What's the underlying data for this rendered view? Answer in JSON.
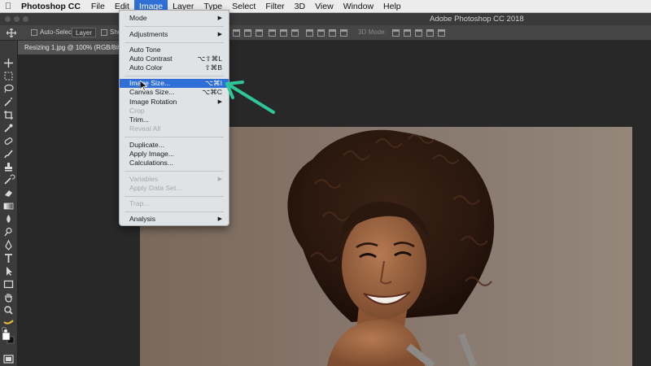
{
  "menubar": {
    "app_name": "Photoshop CC",
    "items": [
      {
        "label": "File"
      },
      {
        "label": "Edit"
      },
      {
        "label": "Image",
        "active": true
      },
      {
        "label": "Layer"
      },
      {
        "label": "Type"
      },
      {
        "label": "Select"
      },
      {
        "label": "Filter"
      },
      {
        "label": "3D"
      },
      {
        "label": "View"
      },
      {
        "label": "Window"
      },
      {
        "label": "Help"
      }
    ]
  },
  "window": {
    "title": "Adobe Photoshop CC 2018"
  },
  "options_bar": {
    "auto_select_label": "Auto-Select:",
    "auto_select_value": "Layer",
    "show_label": "Sho",
    "mode_3d_label": "3D Mode:"
  },
  "document": {
    "tab_label": "Resizing 1.jpg @ 100% (RGB/8#"
  },
  "image_menu": {
    "items": [
      {
        "label": "Mode",
        "submenu": true
      },
      {
        "label": "Adjustments",
        "submenu": true
      },
      {
        "label": "Auto Tone",
        "shortcut": ""
      },
      {
        "label": "Auto Contrast",
        "shortcut": "⌥⇧⌘L"
      },
      {
        "label": "Auto Color",
        "shortcut": "⇧⌘B"
      },
      {
        "label": "Image Size...",
        "shortcut": "⌥⌘I",
        "highlighted": true
      },
      {
        "label": "Canvas Size...",
        "shortcut": "⌥⌘C"
      },
      {
        "label": "Image Rotation",
        "submenu": true
      },
      {
        "label": "Crop",
        "disabled": true
      },
      {
        "label": "Trim..."
      },
      {
        "label": "Reveal All",
        "disabled": true
      },
      {
        "label": "Duplicate..."
      },
      {
        "label": "Apply Image..."
      },
      {
        "label": "Calculations..."
      },
      {
        "label": "Variables",
        "submenu": true,
        "disabled": true
      },
      {
        "label": "Apply Data Set...",
        "disabled": true
      },
      {
        "label": "Trap...",
        "disabled": true
      },
      {
        "label": "Analysis",
        "submenu": true
      }
    ]
  },
  "colors": {
    "highlight": "#2f6fd6",
    "annotation_arrow": "#2fc79a",
    "menu_bg": "#dfe3e6"
  },
  "icons": {
    "apple": "apple-icon",
    "submenu_arrow": "submenu-arrow-icon",
    "annotation": "annotation-arrow-icon"
  }
}
